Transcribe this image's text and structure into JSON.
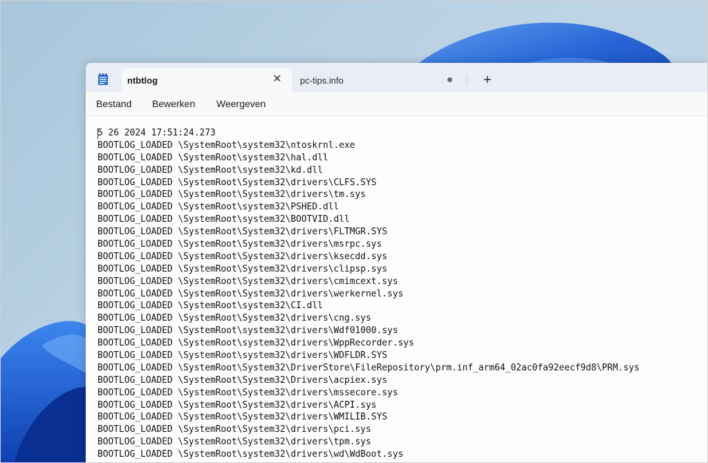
{
  "tabs": [
    {
      "label": "ntbtlog",
      "active": true
    },
    {
      "label": "pc-tips.info",
      "active": false
    }
  ],
  "icons": {
    "app": "notepad-icon",
    "close": "close-icon",
    "unsaved": "unsaved-dot-icon",
    "new_tab": "plus-icon"
  },
  "glyphs": {
    "close": "✕",
    "new_tab": "+"
  },
  "menu": [
    {
      "label": "Bestand"
    },
    {
      "label": "Bewerken"
    },
    {
      "label": "Weergeven"
    }
  ],
  "editor": {
    "lines": [
      "5 26 2024 17:51:24.273",
      "BOOTLOG_LOADED \\SystemRoot\\system32\\ntoskrnl.exe",
      "BOOTLOG_LOADED \\SystemRoot\\system32\\hal.dll",
      "BOOTLOG_LOADED \\SystemRoot\\system32\\kd.dll",
      "BOOTLOG_LOADED \\SystemRoot\\System32\\drivers\\CLFS.SYS",
      "BOOTLOG_LOADED \\SystemRoot\\System32\\drivers\\tm.sys",
      "BOOTLOG_LOADED \\SystemRoot\\system32\\PSHED.dll",
      "BOOTLOG_LOADED \\SystemRoot\\system32\\BOOTVID.dll",
      "BOOTLOG_LOADED \\SystemRoot\\System32\\drivers\\FLTMGR.SYS",
      "BOOTLOG_LOADED \\SystemRoot\\System32\\drivers\\msrpc.sys",
      "BOOTLOG_LOADED \\SystemRoot\\System32\\drivers\\ksecdd.sys",
      "BOOTLOG_LOADED \\SystemRoot\\System32\\drivers\\clipsp.sys",
      "BOOTLOG_LOADED \\SystemRoot\\System32\\drivers\\cmimcext.sys",
      "BOOTLOG_LOADED \\SystemRoot\\System32\\drivers\\werkernel.sys",
      "BOOTLOG_LOADED \\SystemRoot\\system32\\CI.dll",
      "BOOTLOG_LOADED \\SystemRoot\\System32\\drivers\\cng.sys",
      "BOOTLOG_LOADED \\SystemRoot\\system32\\drivers\\Wdf01000.sys",
      "BOOTLOG_LOADED \\SystemRoot\\system32\\drivers\\WppRecorder.sys",
      "BOOTLOG_LOADED \\SystemRoot\\system32\\drivers\\WDFLDR.SYS",
      "BOOTLOG_LOADED \\SystemRoot\\System32\\DriverStore\\FileRepository\\prm.inf_arm64_02ac0fa92eecf9d8\\PRM.sys",
      "BOOTLOG_LOADED \\SystemRoot\\System32\\Drivers\\acpiex.sys",
      "BOOTLOG_LOADED \\SystemRoot\\System32\\drivers\\mssecore.sys",
      "BOOTLOG_LOADED \\SystemRoot\\System32\\drivers\\ACPI.sys",
      "BOOTLOG_LOADED \\SystemRoot\\System32\\drivers\\WMILIB.SYS",
      "BOOTLOG_LOADED \\SystemRoot\\System32\\drivers\\pci.sys",
      "BOOTLOG_LOADED \\SystemRoot\\System32\\drivers\\tpm.sys",
      "BOOTLOG_LOADED \\SystemRoot\\system32\\drivers\\wd\\WdBoot.sys"
    ]
  },
  "colors": {
    "accent_blue": "#1f5fd6",
    "titlebar": "#e9edf5",
    "editor_bg": "#fdfdfd"
  }
}
